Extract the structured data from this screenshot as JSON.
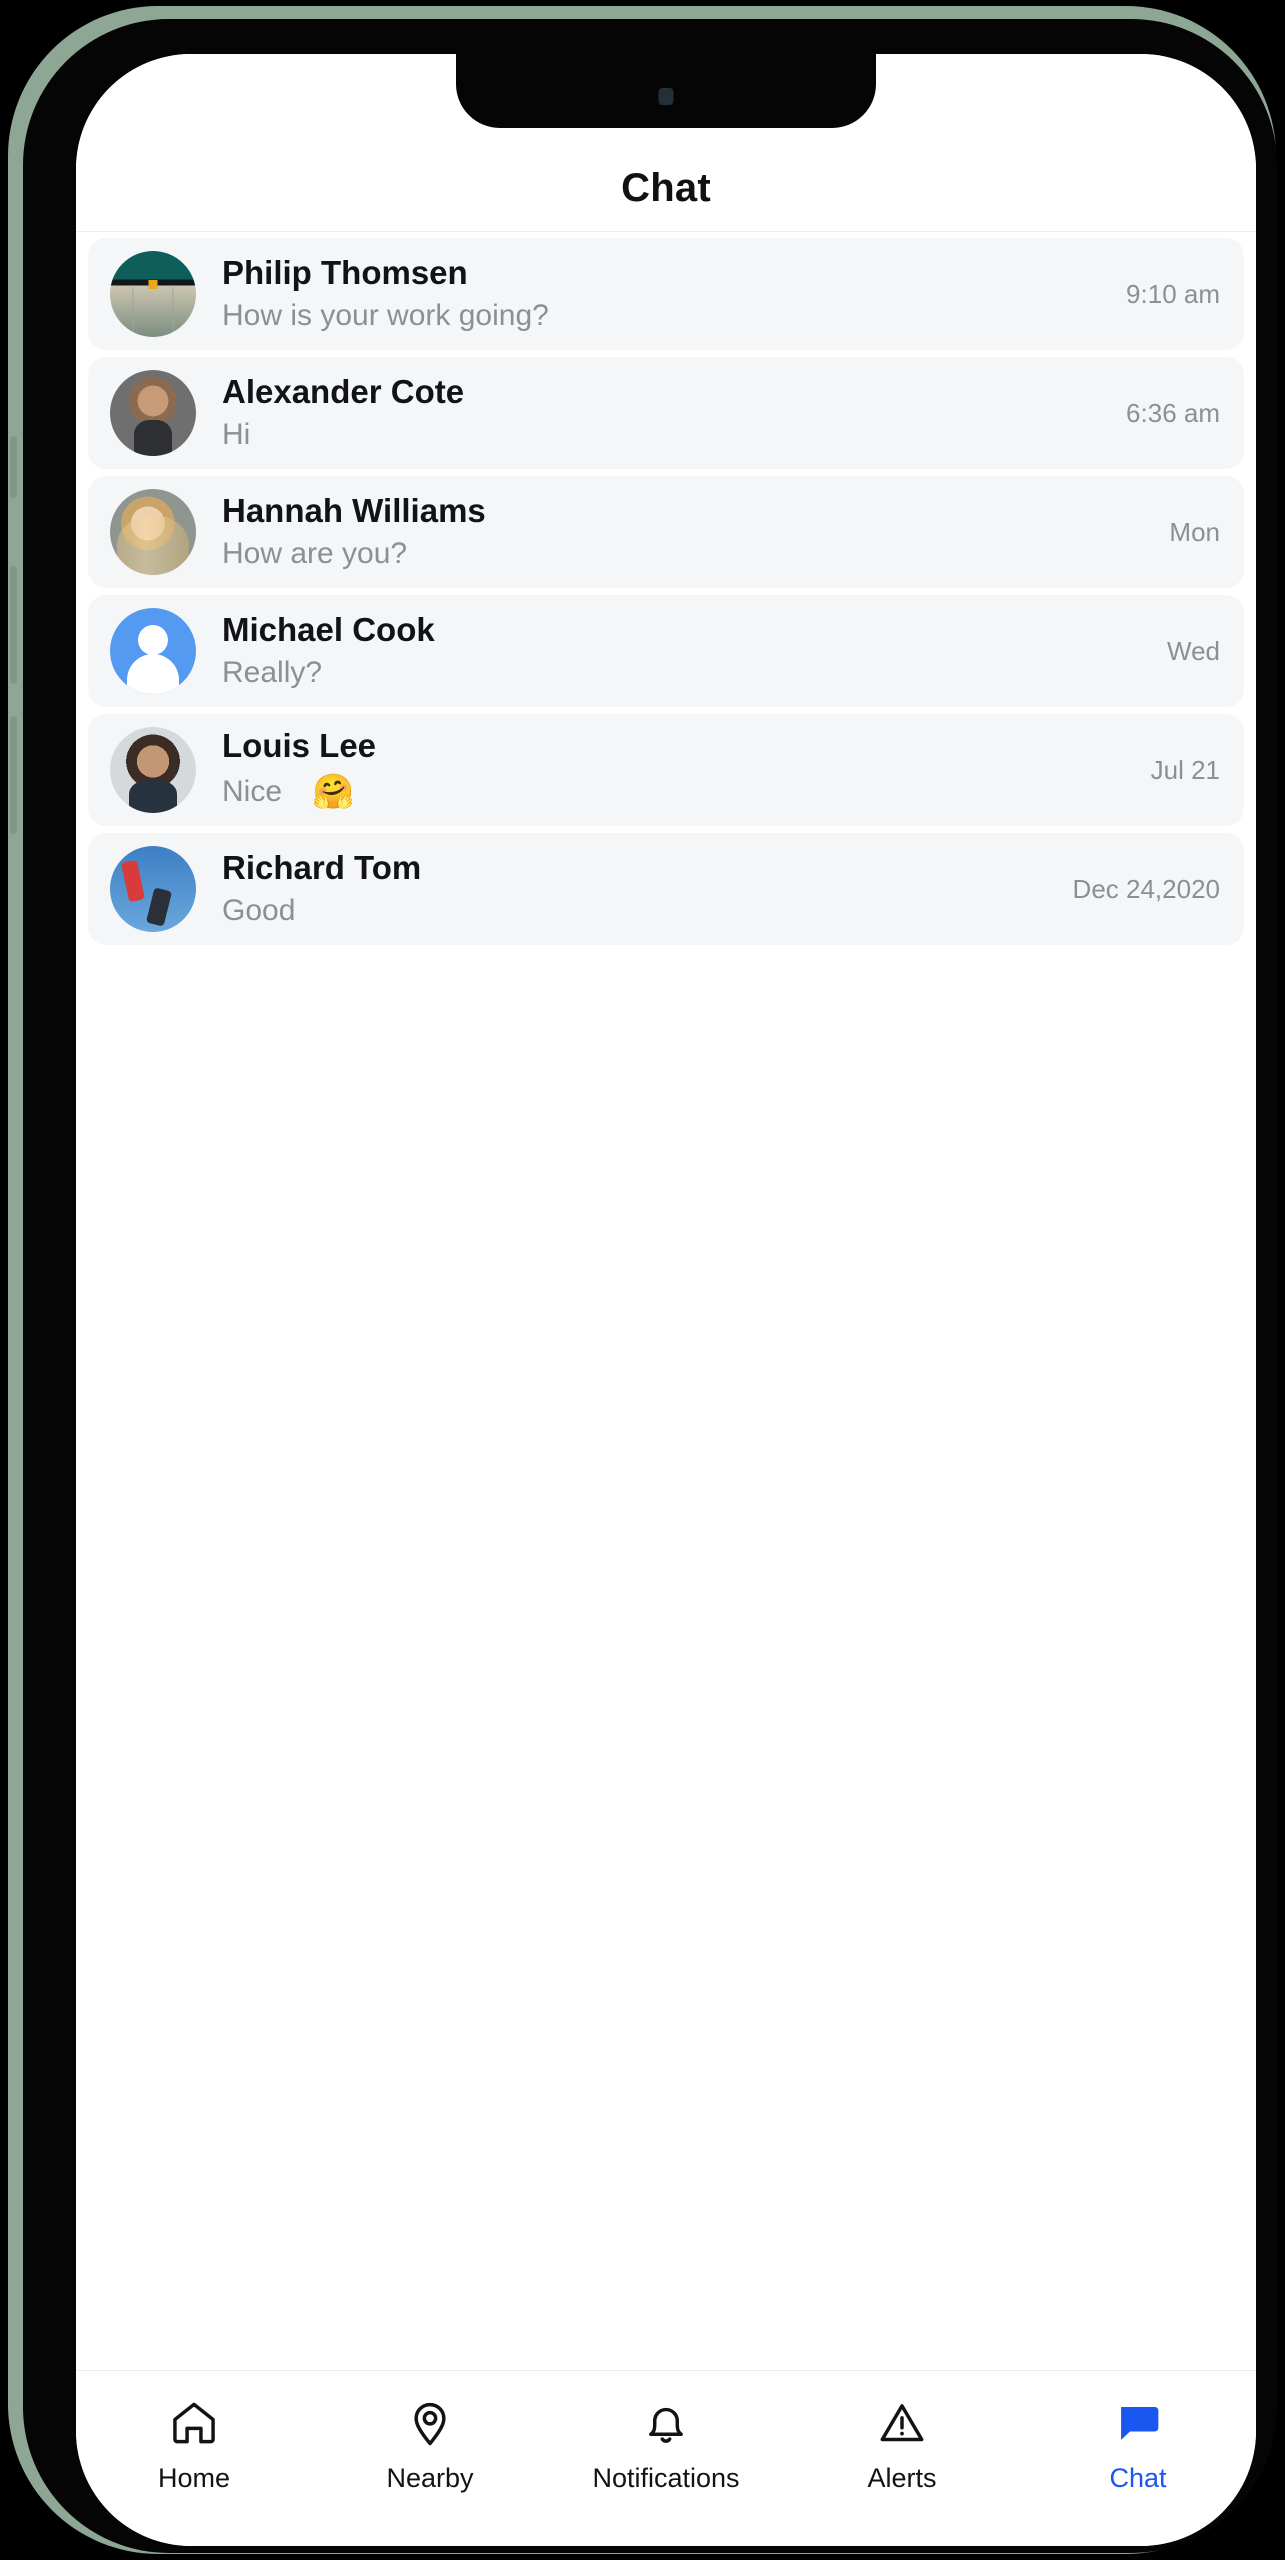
{
  "device": {
    "frame_color": "#8ea694",
    "bezel_color": "#050505",
    "screen_background": "#ffffff"
  },
  "header": {
    "title": "Chat"
  },
  "theme": {
    "accent": "#1a56f0",
    "row_background": "#f5f6f8",
    "name_color": "#111315",
    "muted_color": "#8b8f96"
  },
  "chat_list": {
    "items": [
      {
        "name": "Philip Thomsen",
        "message": "How is your work going?",
        "emoji": "",
        "time": "9:10 am",
        "avatar": "photo-landscape-avatar"
      },
      {
        "name": "Alexander Cote",
        "message": "Hi",
        "emoji": "",
        "time": "6:36 am",
        "avatar": "photo-man-beard-avatar"
      },
      {
        "name": "Hannah Williams",
        "message": "How are you?",
        "emoji": "",
        "time": "Mon",
        "avatar": "photo-woman-blonde-avatar"
      },
      {
        "name": "Michael Cook",
        "message": "Really?",
        "emoji": "",
        "time": "Wed",
        "avatar": "default-person-avatar"
      },
      {
        "name": "Louis Lee",
        "message": "Nice",
        "emoji": "🤗",
        "time": "Jul 21",
        "avatar": "photo-man-dark-hair-avatar"
      },
      {
        "name": "Richard Tom",
        "message": "Good",
        "emoji": "",
        "time": "Dec 24,2020",
        "avatar": "photo-sport-jump-avatar"
      }
    ]
  },
  "tab_bar": {
    "items": [
      {
        "label": "Home",
        "icon": "home-icon",
        "active": false
      },
      {
        "label": "Nearby",
        "icon": "map-pin-icon",
        "active": false
      },
      {
        "label": "Notifications",
        "icon": "bell-icon",
        "active": false
      },
      {
        "label": "Alerts",
        "icon": "warning-triangle-icon",
        "active": false
      },
      {
        "label": "Chat",
        "icon": "chat-bubble-icon",
        "active": true
      }
    ]
  }
}
